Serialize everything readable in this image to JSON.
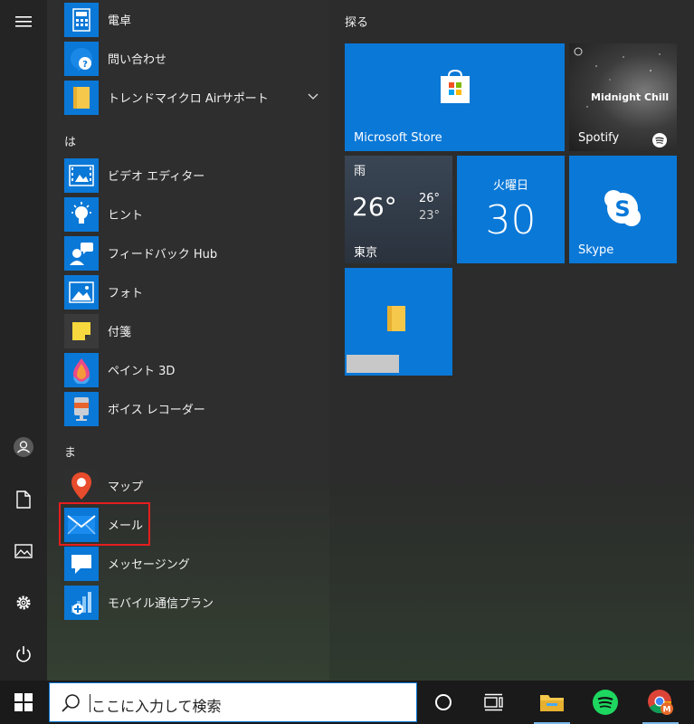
{
  "apps": {
    "calc_label": "電卓",
    "contact_label": "問い合わせ",
    "trend_label": "トレンドマイクロ Airサポート",
    "section_ha": "は",
    "video_label": "ビデオ エディター",
    "tips_label": "ヒント",
    "feedback_label": "フィードバック Hub",
    "photos_label": "フォト",
    "sticky_label": "付箋",
    "paint3d_label": "ペイント 3D",
    "voice_label": "ボイス レコーダー",
    "section_ma": "ま",
    "maps_label": "マップ",
    "mail_label": "メール",
    "messaging_label": "メッセージング",
    "mobile_label": "モバイル通信プラン"
  },
  "tiles": {
    "group_title": "探る",
    "store_label": "Microsoft Store",
    "spotify_label": "Spotify",
    "spotify_playlist": "Midnight Chill",
    "weather_condition": "雨",
    "weather_temp": "26°",
    "weather_high": "26°",
    "weather_low": "23°",
    "weather_city": "東京",
    "calendar_day": "火曜日",
    "calendar_date": "30",
    "skype_label": "Skype"
  },
  "taskbar": {
    "search_placeholder": "ここに入力して検索"
  },
  "colors": {
    "accent": "#0a78d7",
    "highlight": "#e51e1e",
    "spotify": "#1ed760"
  }
}
